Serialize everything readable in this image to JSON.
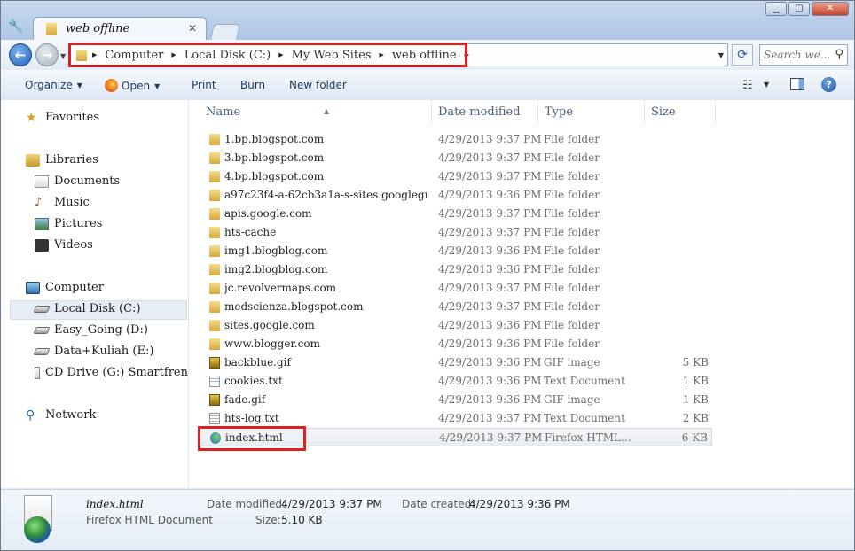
{
  "tab": {
    "title": "web offline"
  },
  "address": {
    "crumbs": [
      "Computer",
      "Local Disk (C:)",
      "My Web Sites",
      "web offline"
    ],
    "search_placeholder": "Search we..."
  },
  "toolbar": {
    "organize": "Organize",
    "open": "Open",
    "print": "Print",
    "burn": "Burn",
    "new_folder": "New folder"
  },
  "nav": {
    "favorites": "Favorites",
    "libraries": "Libraries",
    "documents": "Documents",
    "music": "Music",
    "pictures": "Pictures",
    "videos": "Videos",
    "computer": "Computer",
    "drive_c": "Local Disk (C:)",
    "drive_d": "Easy_Going (D:)",
    "drive_e": "Data+Kuliah (E:)",
    "drive_g": "CD Drive (G:) Smartfren",
    "network": "Network"
  },
  "columns": {
    "name": "Name",
    "date": "Date modified",
    "type": "Type",
    "size": "Size"
  },
  "files": [
    {
      "name": "1.bp.blogspot.com",
      "date": "4/29/2013 9:37 PM",
      "type": "File folder",
      "size": "",
      "icon": "folder"
    },
    {
      "name": "3.bp.blogspot.com",
      "date": "4/29/2013 9:37 PM",
      "type": "File folder",
      "size": "",
      "icon": "folder"
    },
    {
      "name": "4.bp.blogspot.com",
      "date": "4/29/2013 9:37 PM",
      "type": "File folder",
      "size": "",
      "icon": "folder"
    },
    {
      "name": "a97c23f4-a-62cb3a1a-s-sites.googlegroup...",
      "date": "4/29/2013 9:36 PM",
      "type": "File folder",
      "size": "",
      "icon": "folder"
    },
    {
      "name": "apis.google.com",
      "date": "4/29/2013 9:37 PM",
      "type": "File folder",
      "size": "",
      "icon": "folder"
    },
    {
      "name": "hts-cache",
      "date": "4/29/2013 9:37 PM",
      "type": "File folder",
      "size": "",
      "icon": "folder"
    },
    {
      "name": "img1.blogblog.com",
      "date": "4/29/2013 9:36 PM",
      "type": "File folder",
      "size": "",
      "icon": "folder"
    },
    {
      "name": "img2.blogblog.com",
      "date": "4/29/2013 9:36 PM",
      "type": "File folder",
      "size": "",
      "icon": "folder"
    },
    {
      "name": "jc.revolvermaps.com",
      "date": "4/29/2013 9:37 PM",
      "type": "File folder",
      "size": "",
      "icon": "folder"
    },
    {
      "name": "medscienza.blogspot.com",
      "date": "4/29/2013 9:37 PM",
      "type": "File folder",
      "size": "",
      "icon": "folder"
    },
    {
      "name": "sites.google.com",
      "date": "4/29/2013 9:36 PM",
      "type": "File folder",
      "size": "",
      "icon": "folder"
    },
    {
      "name": "www.blogger.com",
      "date": "4/29/2013 9:36 PM",
      "type": "File folder",
      "size": "",
      "icon": "folder"
    },
    {
      "name": "backblue.gif",
      "date": "4/29/2013 9:36 PM",
      "type": "GIF image",
      "size": "5 KB",
      "icon": "gif"
    },
    {
      "name": "cookies.txt",
      "date": "4/29/2013 9:36 PM",
      "type": "Text Document",
      "size": "1 KB",
      "icon": "txt"
    },
    {
      "name": "fade.gif",
      "date": "4/29/2013 9:36 PM",
      "type": "GIF image",
      "size": "1 KB",
      "icon": "gif"
    },
    {
      "name": "hts-log.txt",
      "date": "4/29/2013 9:37 PM",
      "type": "Text Document",
      "size": "2 KB",
      "icon": "txt"
    },
    {
      "name": "index.html",
      "date": "4/29/2013 9:37 PM",
      "type": "Firefox HTML...",
      "size": "6 KB",
      "icon": "html"
    }
  ],
  "details": {
    "name": "index.html",
    "type": "Firefox HTML Document",
    "modified_label": "Date modified:",
    "modified": "4/29/2013 9:37 PM",
    "created_label": "Date created:",
    "created": "4/29/2013 9:36 PM",
    "size_label": "Size:",
    "size": "5.10 KB"
  },
  "colors": {
    "highlight": "#e02020",
    "accent": "#1e395b"
  }
}
